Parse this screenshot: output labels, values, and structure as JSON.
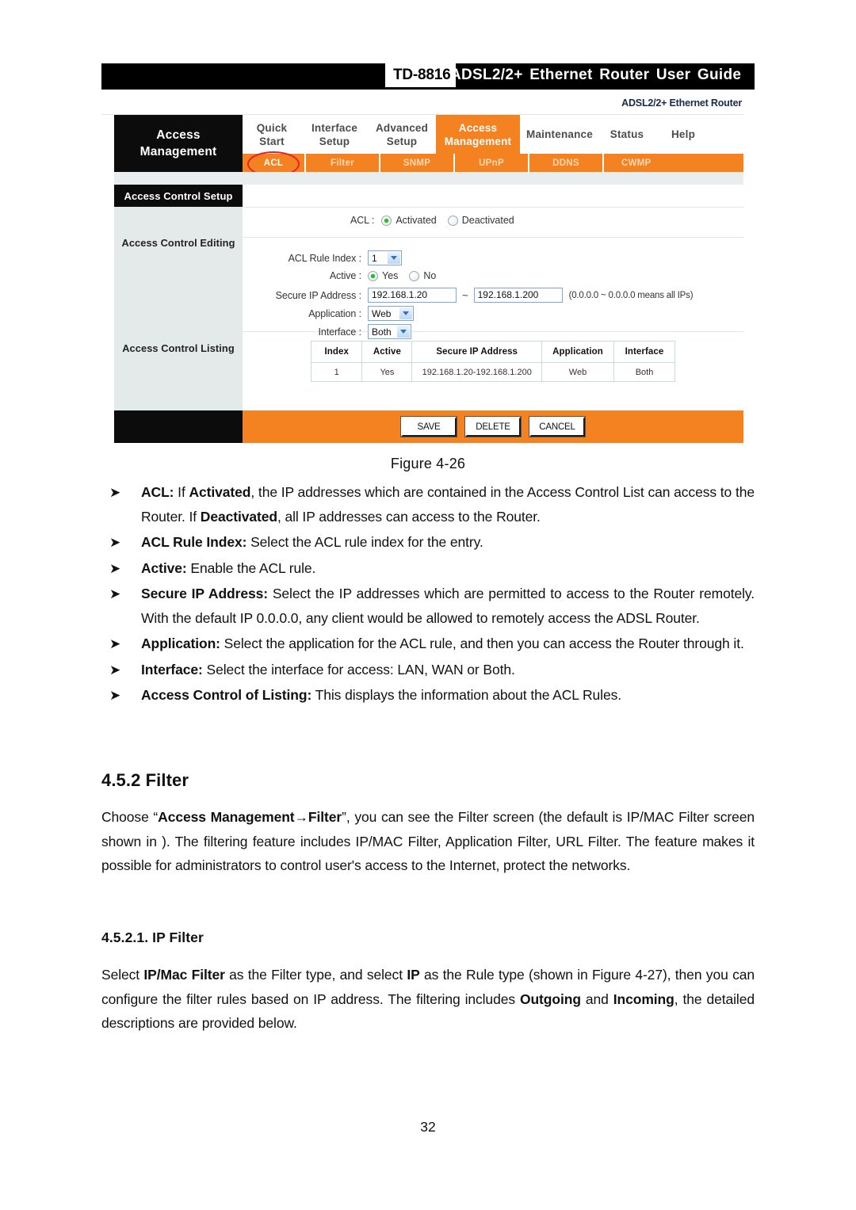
{
  "doc_header": {
    "model": "TD-8816",
    "title": "ADSL2/2+ Ethernet Router User Guide"
  },
  "figure": {
    "brand_label": "ADSL2/2+ Ethernet Router",
    "sidebar_title_line1": "Access",
    "sidebar_title_line2": "Management",
    "main_tabs": [
      {
        "line1": "Quick",
        "line2": "Start"
      },
      {
        "line1": "Interface",
        "line2": "Setup"
      },
      {
        "line1": "Advanced",
        "line2": "Setup"
      },
      {
        "line1": "Access",
        "line2": "Management"
      },
      {
        "line1": "Maintenance",
        "line2": ""
      },
      {
        "line1": "Status",
        "line2": ""
      },
      {
        "line1": "Help",
        "line2": ""
      }
    ],
    "sub_tabs": [
      "ACL",
      "Filter",
      "SNMP",
      "UPnP",
      "DDNS",
      "CWMP"
    ],
    "panel_header": "Access Control Setup",
    "side_section_1": "Access Control Editing",
    "side_section_2": "Access Control Listing",
    "form": {
      "acl_label": "ACL :",
      "acl_option_on": "Activated",
      "acl_option_off": "Deactivated",
      "rule_index_label": "ACL Rule Index :",
      "rule_index_value": "1",
      "active_label": "Active :",
      "active_yes": "Yes",
      "active_no": "No",
      "secure_ip_label": "Secure IP Address :",
      "secure_ip_start": "192.168.1.20",
      "secure_ip_sep": "~",
      "secure_ip_end": "192.168.1.200",
      "secure_ip_note": "(0.0.0.0 ~ 0.0.0.0 means all IPs)",
      "application_label": "Application :",
      "application_value": "Web",
      "interface_label": "Interface :",
      "interface_value": "Both"
    },
    "listing": {
      "headers": [
        "Index",
        "Active",
        "Secure IP Address",
        "Application",
        "Interface"
      ],
      "rows": [
        [
          "1",
          "Yes",
          "192.168.1.20-192.168.1.200",
          "Web",
          "Both"
        ]
      ]
    },
    "buttons": [
      "SAVE",
      "DELETE",
      "CANCEL"
    ],
    "accent_orange": "#F58220",
    "annotation_circle_color": "#e8202a"
  },
  "caption": "Figure 4-26",
  "bullets": [
    {
      "html": "<b>ACL:</b> If <b>Activated</b>, the IP addresses which are contained in the Access Control List can access to the Router. If <b>Deactivated</b>, all IP addresses can access to the Router."
    },
    {
      "html": "<b>ACL Rule Index:</b> Select the ACL rule index for the entry."
    },
    {
      "html": "<b>Active:</b> Enable the ACL rule."
    },
    {
      "html": "<b>Secure IP Address:</b> Select the IP addresses which are permitted to access to the Router remotely. With the default IP 0.0.0.0, any client would be allowed to remotely access the ADSL Router."
    },
    {
      "html": "<b>Application:</b> Select the application for the ACL rule, and then you can access the Router through it."
    },
    {
      "html": "<b>Interface:</b> Select the interface for access: LAN, WAN or Both."
    },
    {
      "html": "<b>Access Control of Listing:</b> This displays the information about the ACL Rules."
    }
  ],
  "section_filter": {
    "heading": "4.5.2  Filter",
    "paragraph_html": "Choose “<b>Access Management→Filter</b>”, you can see the Filter screen (the default is IP/MAC Filter screen shown in ). The filtering feature includes IP/MAC Filter, Application Filter, URL Filter. The feature makes it possible for administrators to control user's access to the Internet, protect the networks."
  },
  "section_ip_filter": {
    "heading": "4.5.2.1.  IP Filter",
    "paragraph_html": "Select <b>IP/Mac Filter</b> as the Filter type, and select <b>IP</b> as the Rule type (shown in Figure 4-27), then you can configure the filter rules based on IP address. The filtering includes <b>Outgoing</b> and <b>Incoming</b>, the detailed descriptions are provided below."
  },
  "page_number": "32",
  "icons": {
    "bullet_arrow": "➤",
    "dropdown_arrow": "chevron-down-icon"
  }
}
